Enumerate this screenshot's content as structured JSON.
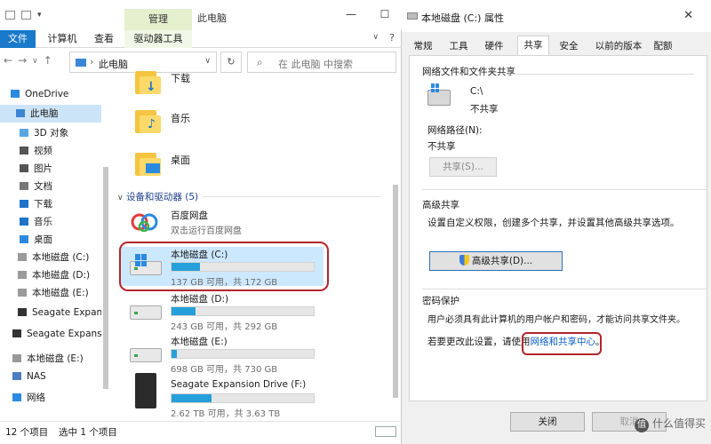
{
  "explorer": {
    "manage_tab": "管理",
    "window_title": "此电脑",
    "controls": {
      "minimize": "—",
      "maximize": "☐",
      "close": "✕"
    },
    "ribbon_tabs": [
      "文件",
      "计算机",
      "查看",
      "驱动器工具"
    ],
    "help": "?",
    "address": "此电脑",
    "search_placeholder": "在 此电脑 中搜索",
    "nav_items": [
      {
        "label": "OneDrive",
        "icon": "cloud-icon"
      },
      {
        "label": "此电脑",
        "icon": "pc-icon"
      },
      {
        "label": "3D 对象",
        "icon": "cube-icon"
      },
      {
        "label": "视频",
        "icon": "video-icon"
      },
      {
        "label": "图片",
        "icon": "picture-icon"
      },
      {
        "label": "文档",
        "icon": "document-icon"
      },
      {
        "label": "下载",
        "icon": "download-icon"
      },
      {
        "label": "音乐",
        "icon": "music-icon"
      },
      {
        "label": "桌面",
        "icon": "desktop-icon"
      },
      {
        "label": "本地磁盘 (C:)",
        "icon": "drive-icon"
      },
      {
        "label": "本地磁盘 (D:)",
        "icon": "drive-icon"
      },
      {
        "label": "本地磁盘 (E:)",
        "icon": "drive-icon"
      },
      {
        "label": "Seagate Expans",
        "icon": "external-drive-icon"
      },
      {
        "label": "Seagate Expansio",
        "icon": "external-drive-icon"
      },
      {
        "label": "本地磁盘 (E:)",
        "icon": "drive-icon"
      },
      {
        "label": "NAS",
        "icon": "nas-icon"
      },
      {
        "label": "网络",
        "icon": "network-icon"
      }
    ],
    "folders": [
      {
        "label": "下载"
      },
      {
        "label": "音乐"
      },
      {
        "label": "桌面"
      }
    ],
    "section_header": "设备和驱动器 (5)",
    "baidu": {
      "name": "百度网盘",
      "sub": "双击运行百度网盘"
    },
    "drives": [
      {
        "name": "本地磁盘 (C:)",
        "free": "137 GB 可用，共 172 GB",
        "used_fraction": 0.2
      },
      {
        "name": "本地磁盘 (D:)",
        "free": "243 GB 可用，共 292 GB",
        "used_fraction": 0.17
      },
      {
        "name": "本地磁盘 (E:)",
        "free": "698 GB 可用，共 730 GB",
        "used_fraction": 0.04
      },
      {
        "name": "Seagate Expansion Drive (F:)",
        "free": "2.62 TB 可用，共 3.63 TB",
        "used_fraction": 0.28
      }
    ],
    "status": {
      "count": "12 个项目",
      "selected": "选中 1 个项目"
    }
  },
  "props": {
    "title": "本地磁盘 (C:) 属性",
    "close": "✕",
    "tabs": [
      "常规",
      "工具",
      "硬件",
      "共享",
      "安全",
      "以前的版本",
      "配额"
    ],
    "share_group": "网络文件和文件夹共享",
    "drive_path": "C:\\",
    "share_state": "不共享",
    "net_path_label": "网络路径(N):",
    "net_path_value": "不共享",
    "share_button": "共享(S)...",
    "advanced_group": "高级共享",
    "advanced_desc": "设置自定义权限，创建多个共享，并设置其他高级共享选项。",
    "advanced_button": "高级共享(D)...",
    "password_group": "密码保护",
    "password_desc": "用户必须具有此计算机的用户帐户和密码，才能访问共享文件夹。",
    "change_prefix": "若要更改此设置，请使用",
    "change_link": "网络和共享中心",
    "change_suffix": "。",
    "footer": {
      "close": "关闭",
      "cancel": "取消"
    },
    "watermark": "什么值得买",
    "watermark_badge": "值"
  }
}
